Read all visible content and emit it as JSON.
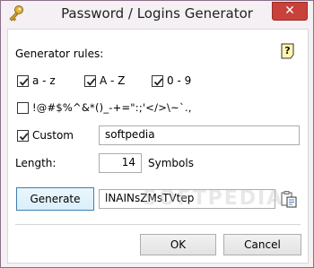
{
  "window": {
    "title": "Password / Logins Generator",
    "close_glyph": "✕"
  },
  "rules": {
    "heading": "Generator rules:",
    "help_glyph": "?",
    "lowercase": {
      "label": "a - z",
      "checked": true
    },
    "uppercase": {
      "label": "A - Z",
      "checked": true
    },
    "digits": {
      "label": "0 - 9",
      "checked": true
    },
    "specials": {
      "label": "!@#$%^&*()_-+=\":;'</>\\~`.,",
      "checked": false
    },
    "custom": {
      "label": "Custom",
      "checked": true,
      "value": "softpedia"
    }
  },
  "length": {
    "label": "Length:",
    "value": "14",
    "unit": "Symbols"
  },
  "generate": {
    "button_label": "Generate",
    "output": "lNAINsZMsTVtep"
  },
  "footer": {
    "ok_label": "OK",
    "cancel_label": "Cancel"
  },
  "watermark": "SOFTPEDIA",
  "icons": {
    "app": "key-icon",
    "help": "help-icon",
    "copy": "copy-clipboard-icon"
  }
}
